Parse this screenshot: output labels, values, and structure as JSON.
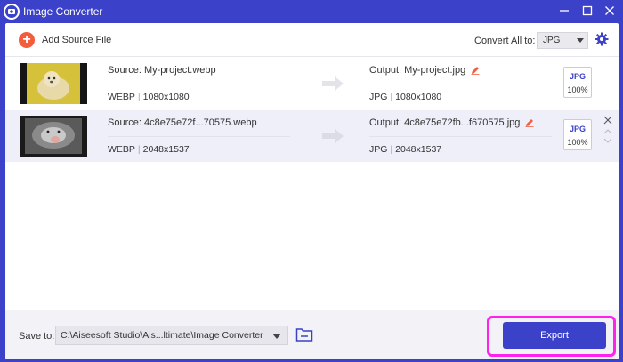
{
  "window": {
    "title": "Image Converter",
    "icons": {
      "logo": "app-logo-icon",
      "minimize": "minimize-icon",
      "maximize": "maximize-icon",
      "close": "close-icon"
    }
  },
  "toolbar": {
    "add_label": "Add Source File",
    "add_icon": "+",
    "convert_all_label": "Convert All to:",
    "convert_all_value": "JPG",
    "settings_icon": "gear-icon"
  },
  "files": [
    {
      "source": "Source: My-project.webp",
      "source_format": "WEBP",
      "source_size": "1080x1080",
      "output": "Output: My-project.jpg",
      "output_format": "JPG",
      "output_size": "1080x1080",
      "badge_format": "JPG",
      "badge_quality": "100%"
    },
    {
      "source": "Source: 4c8e75e72f...70575.webp",
      "source_format": "WEBP",
      "source_size": "2048x1537",
      "output": "Output: 4c8e75e72fb...f670575.jpg",
      "output_format": "JPG",
      "output_size": "2048x1537",
      "badge_format": "JPG",
      "badge_quality": "100%"
    }
  ],
  "footer": {
    "save_label": "Save to:",
    "save_path": "C:\\Aiseesoft Studio\\Ais...ltimate\\Image Converter",
    "export_label": "Export"
  },
  "colors": {
    "accent": "#3b41c9",
    "add_button": "#f45d3c",
    "edit_icon": "#f45d3c",
    "highlight": "#ff22ee"
  }
}
